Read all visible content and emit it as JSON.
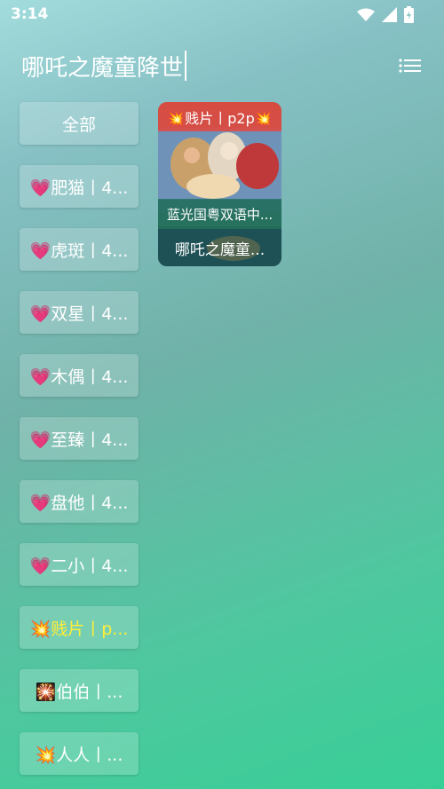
{
  "status_bar": {
    "time": "3:14"
  },
  "search": {
    "query": "哪吒之魔童降世"
  },
  "sidebar": {
    "items": [
      {
        "label": "全部"
      },
      {
        "label": "💗肥猫丨4..."
      },
      {
        "label": "💗虎斑丨4..."
      },
      {
        "label": "💗双星丨4..."
      },
      {
        "label": "💗木偶丨4..."
      },
      {
        "label": "💗至臻丨4..."
      },
      {
        "label": "💗盘他丨4..."
      },
      {
        "label": "💗二小丨4..."
      },
      {
        "label": "💥贱片丨p...",
        "active": true
      },
      {
        "label": "🎇伯伯丨..."
      },
      {
        "label": "💥人人丨..."
      }
    ]
  },
  "results": [
    {
      "tag": "💥贱片丨p2p💥",
      "desc": "蓝光国粤双语中...",
      "title": "哪吒之魔童..."
    }
  ],
  "colors": {
    "active_label": "#ffee3a",
    "tag_bg": "#e6463c"
  }
}
